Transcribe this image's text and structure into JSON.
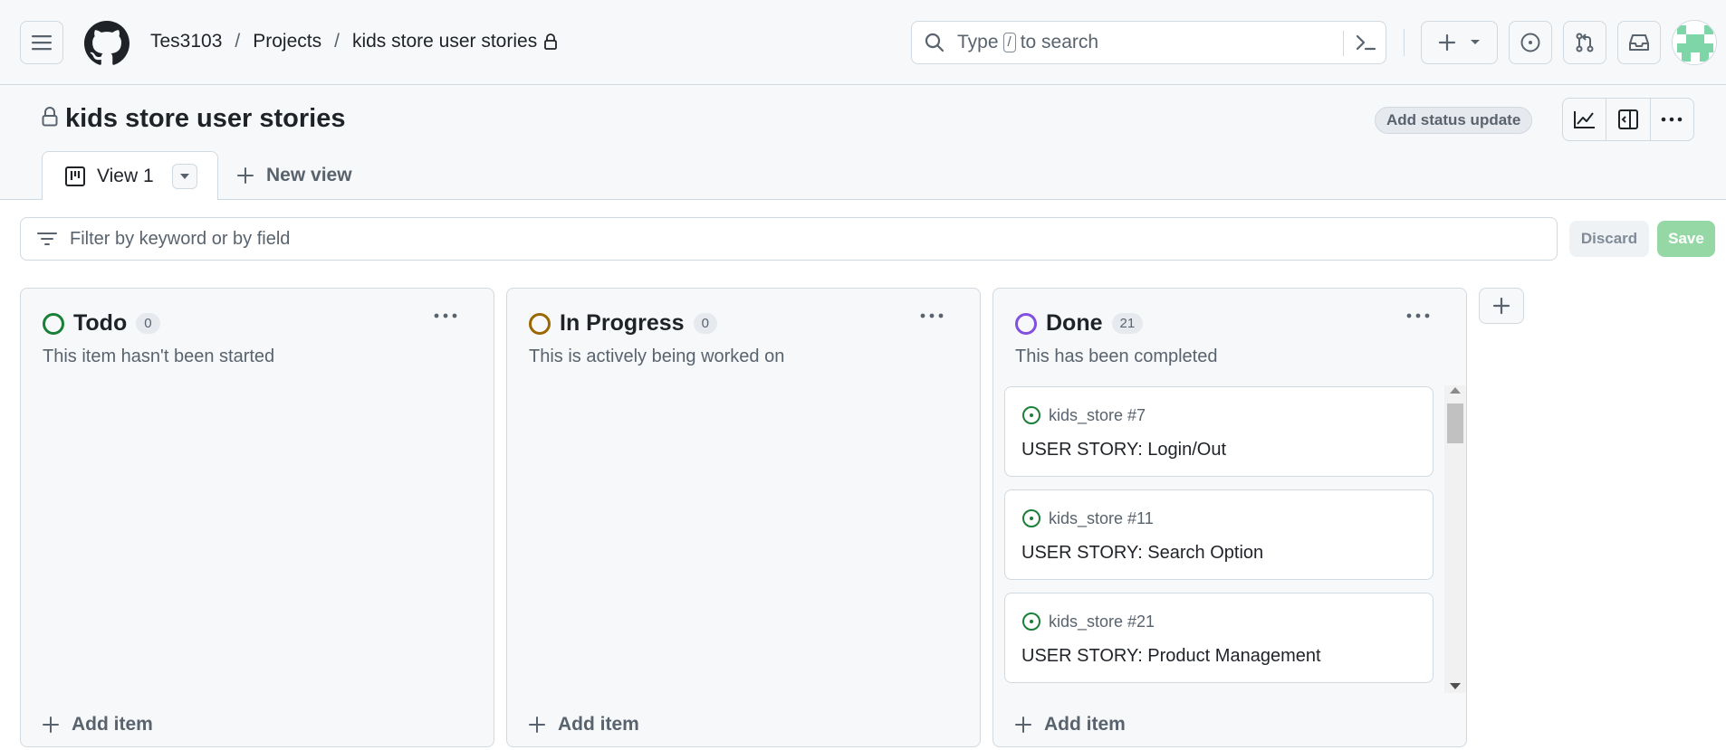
{
  "header": {
    "breadcrumb": {
      "owner": "Tes3103",
      "section": "Projects",
      "project": "kids store user stories"
    },
    "search": {
      "prefix": "Type",
      "key": "/",
      "suffix": "to search"
    }
  },
  "project": {
    "title": "kids store user stories",
    "status_button": "Add status update"
  },
  "tabs": {
    "active": "View 1",
    "new_view": "New view"
  },
  "filter": {
    "placeholder": "Filter by keyword or by field",
    "discard": "Discard",
    "save": "Save"
  },
  "columns": [
    {
      "name": "Todo",
      "count": "0",
      "description": "This item hasn't been started",
      "color": "#1a7f37",
      "add_item": "Add item"
    },
    {
      "name": "In Progress",
      "count": "0",
      "description": "This is actively being worked on",
      "color": "#9a6700",
      "add_item": "Add item"
    },
    {
      "name": "Done",
      "count": "21",
      "description": "This has been completed",
      "color": "#8250df",
      "add_item": "Add item",
      "cards": [
        {
          "ref": "kids_store #7",
          "title": "USER STORY: Login/Out"
        },
        {
          "ref": "kids_store #11",
          "title": "USER STORY: Search Option"
        },
        {
          "ref": "kids_store #21",
          "title": "USER STORY: Product Management"
        }
      ]
    }
  ],
  "colors": {
    "open_issue": "#1a7f37",
    "save_disabled": "#95d8a6"
  }
}
